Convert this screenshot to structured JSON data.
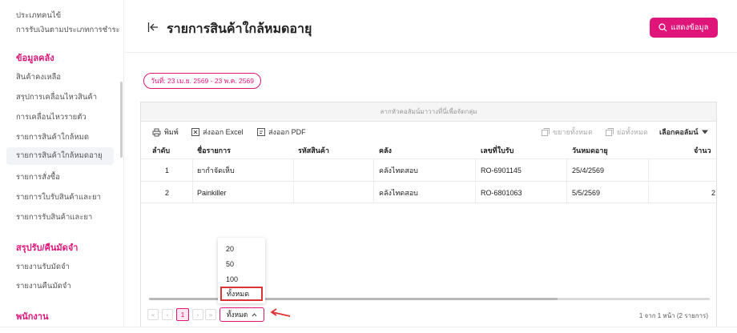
{
  "sidebar": {
    "items": [
      {
        "label": "ประเภทคนไข้"
      },
      {
        "label": "การรับเงินตามประเภทการชำระ"
      },
      {
        "label": "สินค้าคงเหลือ"
      },
      {
        "label": "สรุปการเคลื่อนไหวสินค้า"
      },
      {
        "label": "การเคลื่อนไหวรายตัว"
      },
      {
        "label": "รายการสินค้าใกล้หมด"
      },
      {
        "label": "รายการสินค้าใกล้หมดอายุ"
      },
      {
        "label": "รายการสั่งซื้อ"
      },
      {
        "label": "รายการใบรับสินค้าและยา"
      },
      {
        "label": "รายการรับสินค้าและยา"
      },
      {
        "label": "รายงานรับมัดจำ"
      },
      {
        "label": "รายงานคืนมัดจำ"
      }
    ],
    "sections": [
      {
        "label": "ข้อมูลคลัง"
      },
      {
        "label": "สรุปรับ/คืนมัดจำ"
      },
      {
        "label": "พนักงาน"
      }
    ]
  },
  "header": {
    "title": "รายการสินค้าใกล้หมดอายุ",
    "show_button": "แสดงข้อมูล"
  },
  "filter": {
    "date_range": "วันที่: 23 เม.ย. 2569 - 23 พ.ค. 2569"
  },
  "grid": {
    "group_hint": "ลากหัวคอลัมน์มาวางที่นี่เพื่อจัดกลุ่ม",
    "toolbar": {
      "print": "พิมพ์",
      "export_excel": "ส่งออก Excel",
      "export_pdf": "ส่งออก PDF",
      "expand_all": "ขยายทั้งหมด",
      "collapse_all": "ย่อทั้งหมด",
      "choose_columns": "เลือกคอลัมน์"
    },
    "columns": [
      "ลำดับ",
      "ชื่อรายการ",
      "รหัสสินค้า",
      "คลัง",
      "เลขที่ใบรับ",
      "วันหมดอายุ",
      "จำนว"
    ],
    "rows": [
      {
        "no": "1",
        "name": "ยากำจัดเห็บ",
        "code": "",
        "warehouse": "คลังไทดสอบ",
        "receipt": "RO-6901145",
        "expiry": "25/4/2569",
        "qty": ""
      },
      {
        "no": "2",
        "name": "Painkiller",
        "code": "",
        "warehouse": "คลังไทดสอบ",
        "receipt": "RO-6801063",
        "expiry": "5/5/2569",
        "qty": "2"
      }
    ]
  },
  "pager": {
    "first": "«",
    "prev": "‹",
    "current_page": "1",
    "next": "›",
    "last": "»",
    "page_size": "ทั้งหมด",
    "info": "1 จาก 1 หน้า (2 รายการ)",
    "options": [
      "20",
      "50",
      "100",
      "ทั้งหมด"
    ]
  },
  "colors": {
    "accent": "#e0157a",
    "highlight_box": "#dd3333"
  }
}
